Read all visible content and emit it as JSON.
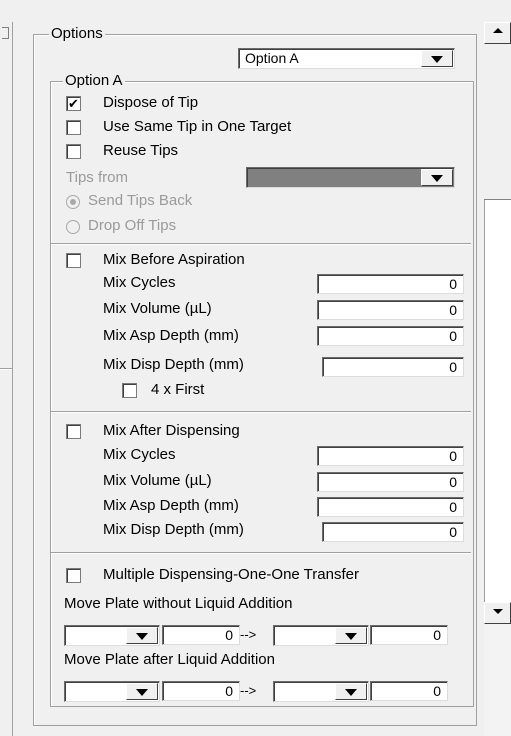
{
  "options_group": {
    "title": "Options",
    "selector_value": "Option A"
  },
  "option_a_group": {
    "title": "Option A",
    "dispose_of_tip": {
      "label": "Dispose of Tip",
      "checked": true
    },
    "use_same_tip": {
      "label": "Use Same Tip in One Target",
      "checked": false
    },
    "reuse_tips": {
      "label": "Reuse Tips",
      "checked": false
    },
    "tips_from_label": "Tips from",
    "send_tips_back": {
      "label": "Send Tips Back",
      "selected": true
    },
    "drop_off_tips": {
      "label": "Drop Off Tips",
      "selected": false
    }
  },
  "mix_before": {
    "label": "Mix Before Aspiration",
    "checked": false,
    "fields": [
      {
        "label": "Mix Cycles",
        "value": "0"
      },
      {
        "label": "Mix Volume (µL)",
        "value": "0"
      },
      {
        "label": "Mix Asp Depth (mm)",
        "value": "0"
      },
      {
        "label": "Mix Disp Depth (mm)",
        "value": "0"
      }
    ],
    "four_x_first": {
      "label": "4 x First",
      "checked": false
    }
  },
  "mix_after": {
    "label": "Mix After Dispensing",
    "checked": false,
    "fields": [
      {
        "label": "Mix Cycles",
        "value": "0"
      },
      {
        "label": "Mix Volume (µL)",
        "value": "0"
      },
      {
        "label": "Mix Asp Depth (mm)",
        "value": "0"
      },
      {
        "label": "Mix Disp Depth (mm)",
        "value": "0"
      }
    ]
  },
  "multiple_dispensing": {
    "label": "Multiple Dispensing-One-One Transfer",
    "checked": false
  },
  "move_plate_without": {
    "label": "Move Plate without Liquid Addition",
    "from_value": "0",
    "arrow": "-->",
    "to_value": "0"
  },
  "move_plate_after": {
    "label": "Move Plate after Liquid Addition",
    "from_value": "0",
    "arrow": "-->",
    "to_value": "0"
  },
  "colors": {
    "window_bg": "#f0f0f0",
    "disabled_text": "#9a9a9a",
    "disabled_combo": "#808080"
  }
}
